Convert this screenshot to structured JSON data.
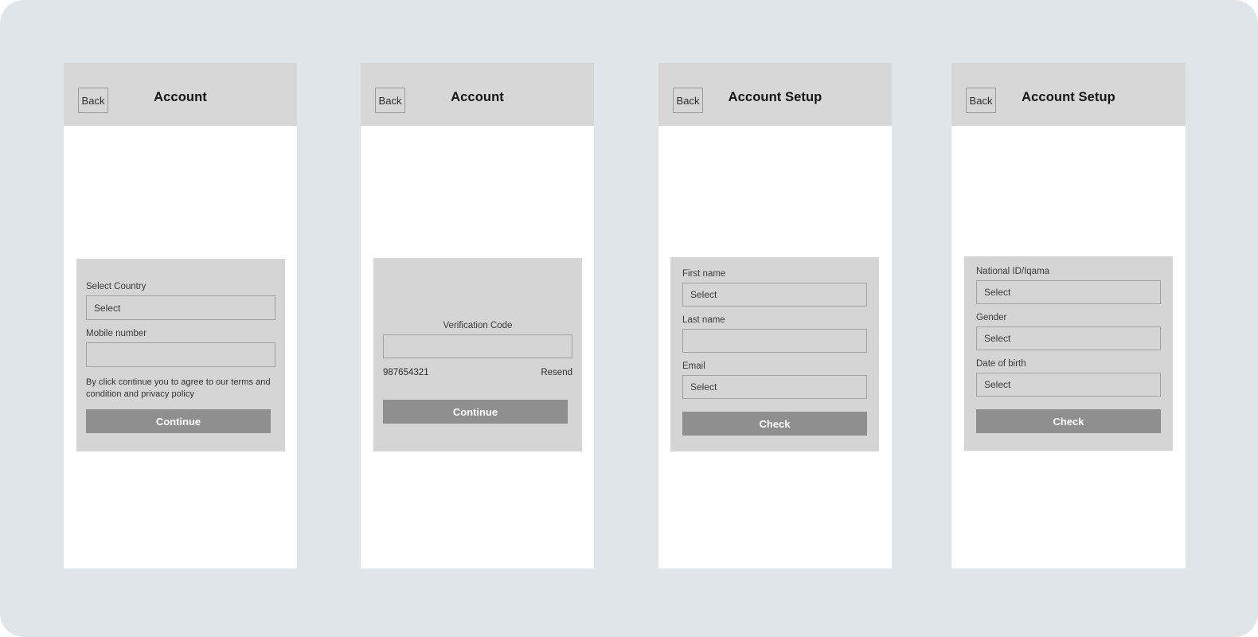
{
  "canvas": {
    "background_color": "#dfe5e9",
    "header_color": "#d7d7d7",
    "card_color": "#d5d5d5",
    "button_color": "#8f8f8f",
    "screen_color": "#ffffff"
  },
  "screens": [
    {
      "id": "account-country",
      "back_label": "Back",
      "title": "Account",
      "fields": [
        {
          "label": "Select Country",
          "value": "Select"
        },
        {
          "label": "Mobile number",
          "value": ""
        }
      ],
      "terms": "By click continue you to agree to our terms and condition and privacy policy",
      "submit_label": "Continue"
    },
    {
      "id": "account-verification",
      "back_label": "Back",
      "title": "Account",
      "code_label": "Verification Code",
      "code_value": "",
      "phone_number": "987654321",
      "resend_label": "Resend",
      "submit_label": "Continue"
    },
    {
      "id": "account-setup-personal",
      "back_label": "Back",
      "title": "Account Setup",
      "fields": [
        {
          "label": "First name",
          "value": "Select"
        },
        {
          "label": "Last name",
          "value": ""
        },
        {
          "label": "Email",
          "value": "Select"
        }
      ],
      "submit_label": "Check"
    },
    {
      "id": "account-setup-identity",
      "back_label": "Back",
      "title": "Account Setup",
      "fields": [
        {
          "label": "National ID/Iqama",
          "value": "Select"
        },
        {
          "label": "Gender",
          "value": "Select"
        },
        {
          "label": "Date of birth",
          "value": "Select"
        }
      ],
      "submit_label": "Check"
    }
  ]
}
